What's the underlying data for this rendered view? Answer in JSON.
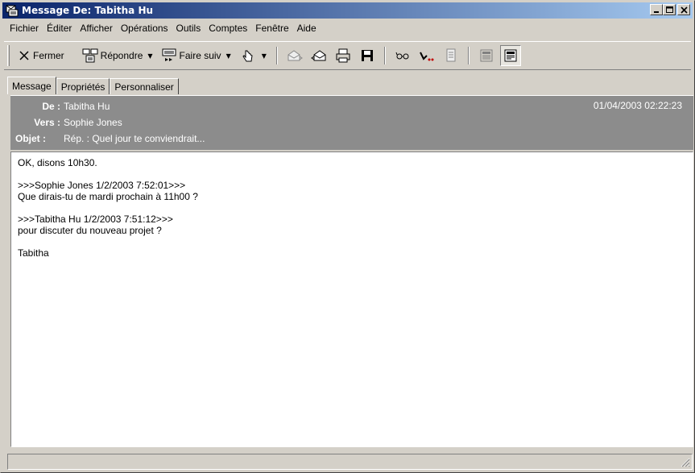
{
  "window": {
    "title": "Message De: Tabitha Hu",
    "icon": "message-icon"
  },
  "menu": [
    "Fichier",
    "Éditer",
    "Afficher",
    "Opérations",
    "Outils",
    "Comptes",
    "Fenêtre",
    "Aide"
  ],
  "toolbar": {
    "close_label": "Fermer",
    "reply_label": "Répondre",
    "forward_label": "Faire suiv"
  },
  "tabs": [
    "Message",
    "Propriétés",
    "Personnaliser"
  ],
  "header": {
    "from_label": "De :",
    "from_value": "Tabitha Hu",
    "to_label": "Vers :",
    "to_value": "Sophie Jones",
    "subject_label": "Objet :",
    "subject_value": "Rép. : Quel jour te conviendrait...",
    "date": "01/04/2003 02:22:23"
  },
  "body": {
    "lines": [
      "OK, disons 10h30.",
      "",
      ">>>Sophie Jones 1/2/2003 7:52:01>>>",
      "Que dirais-tu de mardi prochain à 11h00 ?",
      "",
      ">>>Tabitha Hu 1/2/2003 7:51:12>>>",
      "pour discuter du nouveau projet ?",
      "",
      "Tabitha"
    ]
  },
  "colors": {
    "title_start": "#0a246a",
    "title_end": "#a6caf0",
    "header_bg": "#8c8c8c",
    "face": "#d4d0c8"
  }
}
